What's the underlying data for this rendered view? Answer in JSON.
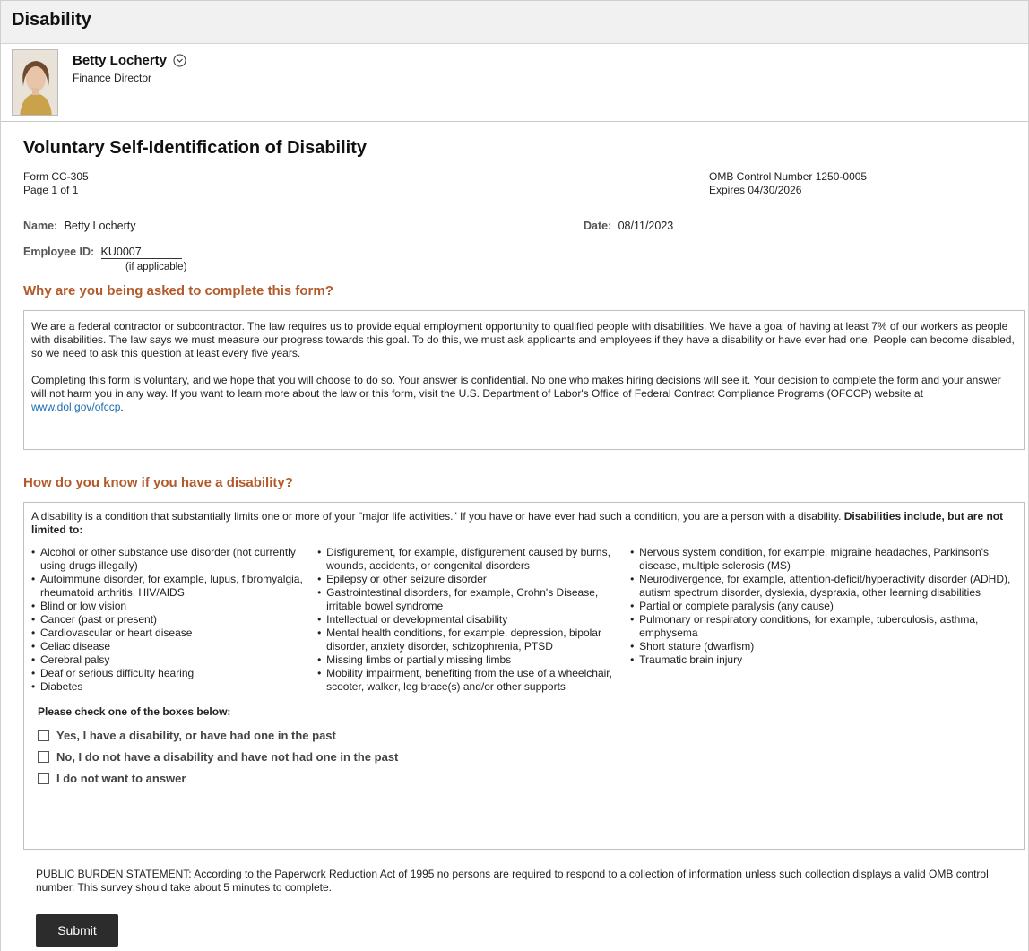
{
  "header": {
    "title": "Disability"
  },
  "person": {
    "name": "Betty Locherty",
    "job_title": "Finance Director"
  },
  "form": {
    "title": "Voluntary Self-Identification of Disability",
    "form_number": "Form CC-305",
    "page": "Page 1 of 1",
    "omb": "OMB Control Number 1250-0005",
    "expires": "Expires 04/30/2026",
    "name_label": "Name:",
    "name_value": "Betty Locherty",
    "date_label": "Date:",
    "date_value": "08/11/2023",
    "employee_id_label": "Employee ID:",
    "employee_id_value": "KU0007",
    "employee_id_note": "(if applicable)"
  },
  "why": {
    "heading": "Why are you being asked to complete this form?",
    "para1": "We are a federal contractor or subcontractor. The law requires us to provide equal employment opportunity to qualified people with disabilities. We have a goal of having at least 7% of our workers as people with disabilities. The law says we must measure our progress towards this goal. To do this, we must ask applicants and employees if they have a disability or have ever had one. People can become disabled, so we need to ask this question at least every five years.",
    "para2": "Completing this form is voluntary, and we hope that you will choose to do so. Your answer is confidential. No one who makes hiring decisions will see it. Your decision to complete the form and your answer will not harm you in any way. If you want to learn more about the law or this form, visit the U.S. Department of Labor's Office of Federal Contract Compliance Programs (OFCCP) website at",
    "link": "www.dol.gov/ofccp",
    "para2_end": "."
  },
  "how": {
    "heading": "How do you know if you have a disability?",
    "intro": "A disability is a condition that substantially limits one or more of your \"major life activities.\" If you have or have ever had such a condition, you are a person with a disability.",
    "intro_bold": "Disabilities include, but are not limited to:",
    "col1": [
      "Alcohol or other substance use disorder (not currently using drugs illegally)",
      "Autoimmune disorder, for example, lupus, fibromyalgia, rheumatoid arthritis, HIV/AIDS",
      "Blind or low vision",
      "Cancer (past or present)",
      "Cardiovascular or heart disease",
      "Celiac disease",
      "Cerebral palsy",
      "Deaf or serious difficulty hearing",
      "Diabetes"
    ],
    "col2": [
      "Disfigurement, for example, disfigurement caused by burns, wounds, accidents, or congenital disorders",
      "Epilepsy or other seizure disorder",
      "Gastrointestinal disorders, for example, Crohn's Disease, irritable bowel syndrome",
      "Intellectual or developmental disability",
      "Mental health conditions, for example, depression, bipolar disorder, anxiety disorder, schizophrenia, PTSD",
      "Missing limbs or partially missing limbs",
      "Mobility impairment, benefiting from the use of a wheelchair, scooter, walker, leg brace(s) and/or other supports"
    ],
    "col3": [
      "Nervous system condition, for example, migraine headaches, Parkinson's disease, multiple sclerosis (MS)",
      "Neurodivergence, for example, attention-deficit/hyperactivity disorder (ADHD), autism spectrum disorder, dyslexia, dyspraxia, other learning disabilities",
      "Partial or complete paralysis (any cause)",
      "Pulmonary or respiratory conditions, for example, tuberculosis, asthma, emphysema",
      "Short stature (dwarfism)",
      "Traumatic brain injury"
    ],
    "check_heading": "Please check one of the boxes below:",
    "options": [
      "Yes, I have a disability, or have had one in the past",
      "No, I do not have a disability and have not had one in the past",
      "I do not want to answer"
    ]
  },
  "burden": "PUBLIC BURDEN STATEMENT: According to the Paperwork Reduction Act of 1995 no persons are required to respond to a collection of information unless such collection displays a valid OMB control number. This survey should take about 5 minutes to complete.",
  "submit_label": "Submit"
}
